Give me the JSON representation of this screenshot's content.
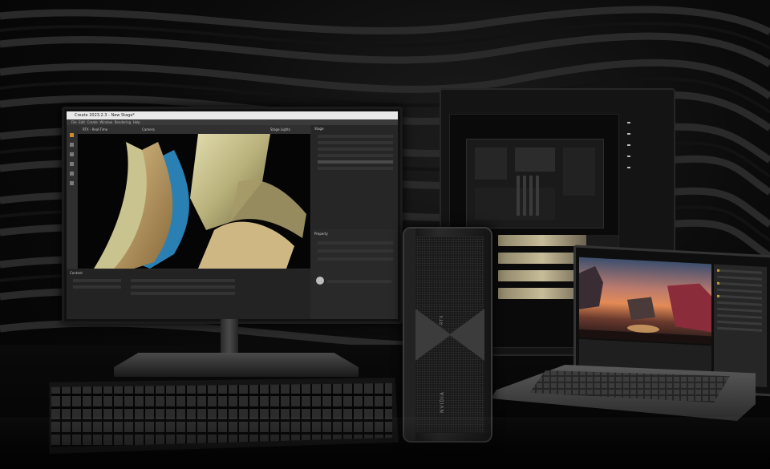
{
  "scene": {
    "description_type": "product-photo",
    "colors": {
      "background": "#050505",
      "gpu_accent": "#c8bd99",
      "render_cloth": "#c9c48f",
      "render_blue": "#2a7fb3",
      "sunset": "#e48b56"
    }
  },
  "monitor_app": {
    "window_title": "Create 2023.2.3 - New Stage*",
    "menu": [
      "File",
      "Edit",
      "Create",
      "Window",
      "Rendering",
      "Help"
    ],
    "viewport_toolbar": [
      "RTX - Real-Time",
      "Camera",
      "Stage Lights"
    ],
    "panel_stage_title": "Stage",
    "panel_property_title": "Property",
    "panel_content_title": "Content"
  },
  "gpu": {
    "brand_text": "NVIDIA",
    "side_text": "RTX"
  }
}
